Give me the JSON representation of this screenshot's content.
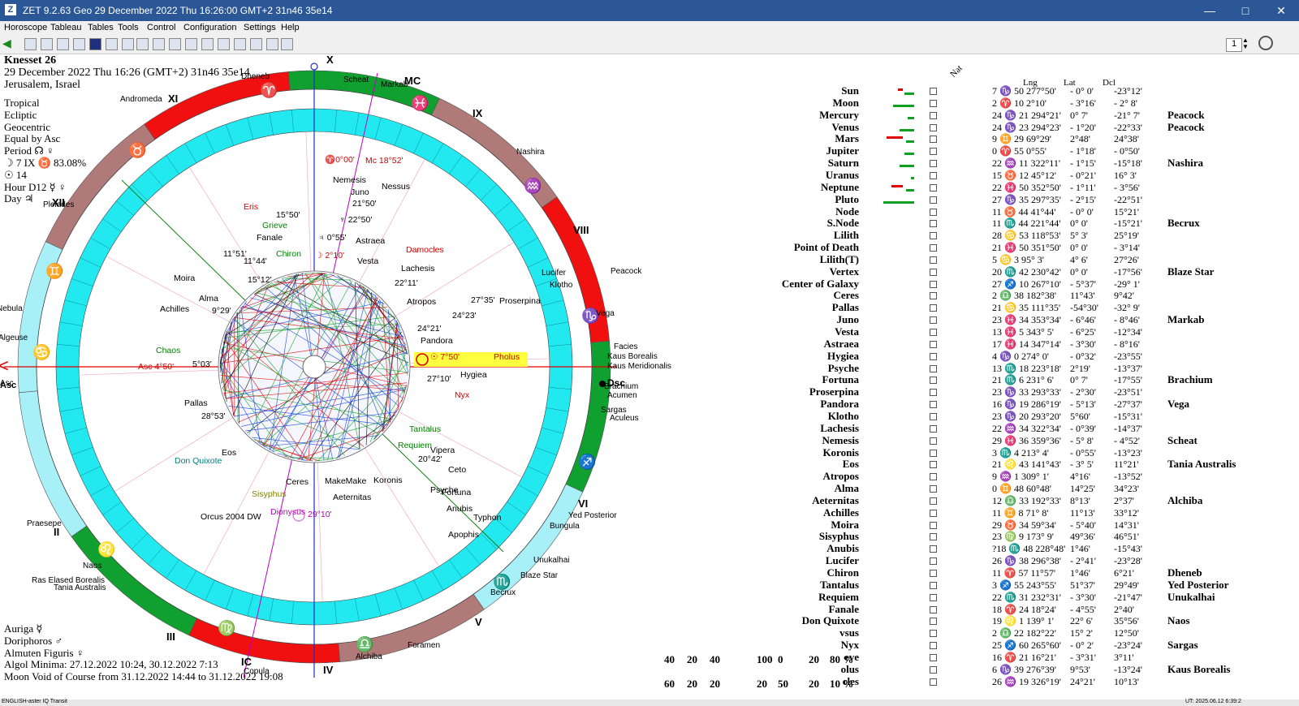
{
  "window": {
    "title": "ZET 9.2.63 Geo   29 December 2022  Thu  16:26:00 GMT+2 31n46  35e14",
    "app_icon": "zet-logo-icon",
    "controls": [
      "minimize",
      "maximize",
      "close"
    ]
  },
  "menu": [
    "Horoscope",
    "Tableau",
    "Tables",
    "Tools",
    "Control",
    "Configuration",
    "Settings",
    "Help"
  ],
  "toolbar": {
    "page_value": "1"
  },
  "chart_info": {
    "name": "Knesset 26",
    "datetime": "29 December 2022  Thu   16:26 (GMT+2) 31n46  35e14",
    "location": "Jerusalem, Israel",
    "lines": [
      "Tropical",
      "Ecliptic",
      "Geocentric",
      "Equal by Asc",
      "Period ☊ ♀",
      "☽ 7 IX ♉ 83.08%",
      "☉ 14",
      "Hour D12 ☿ ♀",
      "Day ♃"
    ]
  },
  "bottom_info": {
    "lines": [
      "Auriga ☿",
      "Doriphoros ♂",
      "Almuten Figuris ♀",
      "Algol Minima: 27.12.2022 10:24,  30.12.2022 7:13",
      "Moon Void of Course from 31.12.2022 14:44 to 31.12.2022 19:08"
    ]
  },
  "wheel": {
    "axis_labels": {
      "top": "X",
      "mc": "MC",
      "ic": "IC",
      "asc": "Asc",
      "dsc": "Dsc",
      "bottom": "IV"
    },
    "house_numbers": [
      "XI",
      "IX",
      "XII",
      "VIII",
      "II",
      "VI",
      "III",
      "V"
    ],
    "zodiac_glyphs": [
      "♈",
      "♓",
      "♒",
      "♑",
      "♐",
      "♏",
      "♎",
      "♍",
      "♌",
      "♋",
      "♊",
      "♉"
    ],
    "planet_labels": [
      {
        "text": "♈0°00'",
        "color": "#d00000"
      },
      {
        "text": "Mc 18°52'",
        "color": "#d00000"
      },
      {
        "text": "Asc 4°50'",
        "color": "#d00000"
      },
      {
        "text": "Nemesis",
        "color": "#000"
      },
      {
        "text": "Juno",
        "color": "#000"
      },
      {
        "text": "Nessus",
        "color": "#000"
      },
      {
        "text": "21°50'",
        "color": "#000"
      },
      {
        "text": "♆ 22°50'",
        "color": "#000"
      },
      {
        "text": "♃ 0°55'",
        "color": "#000"
      },
      {
        "text": "Astraea",
        "color": "#000"
      },
      {
        "text": "Damocles",
        "color": "#d00000"
      },
      {
        "text": "☽ 2°10'",
        "color": "#d00000"
      },
      {
        "text": "Vesta",
        "color": "#000"
      },
      {
        "text": "Lachesis",
        "color": "#000"
      },
      {
        "text": "22°11'",
        "color": "#000"
      },
      {
        "text": "Atropos",
        "color": "#000"
      },
      {
        "text": "27°35'",
        "color": "#000"
      },
      {
        "text": "Proserpina",
        "color": "#000"
      },
      {
        "text": "24°23'",
        "color": "#000"
      },
      {
        "text": "24°21'",
        "color": "#000"
      },
      {
        "text": "Pandora",
        "color": "#000"
      },
      {
        "text": "☉ 7°50'",
        "color": "#d00000"
      },
      {
        "text": "Pholus",
        "color": "#d00000"
      },
      {
        "text": "27°10'",
        "color": "#000"
      },
      {
        "text": "Hygiea",
        "color": "#000"
      },
      {
        "text": "Nyx",
        "color": "#d00000"
      },
      {
        "text": "Tantalus",
        "color": "#008000"
      },
      {
        "text": "Requiem",
        "color": "#008000"
      },
      {
        "text": "Vipera",
        "color": "#000"
      },
      {
        "text": "20°42'",
        "color": "#000"
      },
      {
        "text": "Ceto",
        "color": "#000"
      },
      {
        "text": "Fortuna",
        "color": "#000"
      },
      {
        "text": "Psyche",
        "color": "#000"
      },
      {
        "text": "Koronis",
        "color": "#000"
      },
      {
        "text": "MakeMake",
        "color": "#000"
      },
      {
        "text": "Aeternitas",
        "color": "#000"
      },
      {
        "text": "Anubis",
        "color": "#000"
      },
      {
        "text": "Typhon",
        "color": "#000"
      },
      {
        "text": "Apophis",
        "color": "#000"
      },
      {
        "text": "Ceres",
        "color": "#000"
      },
      {
        "text": "Sisyphus",
        "color": "#808000"
      },
      {
        "text": "Dionysus",
        "color": "#c000c0"
      },
      {
        "text": "29°10'",
        "color": "#c000c0"
      },
      {
        "text": "Orcus 2004 DW",
        "color": "#000"
      },
      {
        "text": "Don Quixote",
        "color": "#008080"
      },
      {
        "text": "Eos",
        "color": "#000"
      },
      {
        "text": "Pallas",
        "color": "#000"
      },
      {
        "text": "28°53'",
        "color": "#000"
      },
      {
        "text": "5°03'",
        "color": "#000"
      },
      {
        "text": "Chaos",
        "color": "#008000"
      },
      {
        "text": "Achilles",
        "color": "#000"
      },
      {
        "text": "9°29'",
        "color": "#000"
      },
      {
        "text": "Alma",
        "color": "#000"
      },
      {
        "text": "Moira",
        "color": "#000"
      },
      {
        "text": "15°12'",
        "color": "#000"
      },
      {
        "text": "11°51'",
        "color": "#000"
      },
      {
        "text": "11°44'",
        "color": "#000"
      },
      {
        "text": "Chiron",
        "color": "#008000"
      },
      {
        "text": "Fanale",
        "color": "#000"
      },
      {
        "text": "Grieve",
        "color": "#008000"
      },
      {
        "text": "15°50'",
        "color": "#000"
      },
      {
        "text": "Eris",
        "color": "#d00000"
      }
    ],
    "star_labels": [
      "Andromeda",
      "Dheneb",
      "Scheat",
      "Markab",
      "Nashira",
      "Peacock",
      "Vega",
      "Lucifer",
      "Klotho",
      "Facies",
      "Kaus Borealis",
      "Kaus Meridionalis",
      "Brachium",
      "Acumen",
      "Sargas",
      "Aculeus",
      "Yed Posterior",
      "Bungula",
      "Unukalhai",
      "Blaze Star",
      "Becrux",
      "Foramen",
      "Alchiba",
      "Copula",
      "Naos",
      "Ras Elased Borealis",
      "Tania Australis",
      "Praesepe",
      "Pleiades",
      "Nebula",
      "Algeuse",
      "Asc"
    ]
  },
  "table": {
    "headers": [
      "Nat",
      "Lng",
      "Lat",
      "Dcl"
    ],
    "rows": [
      {
        "name": "Sun",
        "lng": "7 ♑ 50  277°50'",
        "lat": "- 0° 0'",
        "dcl": "-23°12'",
        "star": ""
      },
      {
        "name": "Moon",
        "lng": "2 ♈ 10    2°10'",
        "lat": "- 3°16'",
        "dcl": "- 2° 8'",
        "star": ""
      },
      {
        "name": "Mercury",
        "lng": "24 ♑ 21  294°21'",
        "lat": "0° 7'",
        "dcl": "-21° 7'",
        "star": "Peacock"
      },
      {
        "name": "Venus",
        "lng": "24 ♑ 23  294°23'",
        "lat": "- 1°20'",
        "dcl": "-22°33'",
        "star": "Peacock"
      },
      {
        "name": "Mars",
        "lng": "9 ♊ 29   69°29'",
        "lat": "2°48'",
        "dcl": "24°38'",
        "star": ""
      },
      {
        "name": "Jupiter",
        "lng": "0 ♈ 55    0°55'",
        "lat": "- 1°18'",
        "dcl": "- 0°50'",
        "star": ""
      },
      {
        "name": "Saturn",
        "lng": "22 ♒ 11  322°11'",
        "lat": "- 1°15'",
        "dcl": "-15°18'",
        "star": "Nashira"
      },
      {
        "name": "Uranus",
        "lng": "15 ♉ 12   45°12'",
        "lat": "- 0°21'",
        "dcl": "16° 3'",
        "star": ""
      },
      {
        "name": "Neptune",
        "lng": "22 ♓ 50  352°50'",
        "lat": "- 1°11'",
        "dcl": "- 3°56'",
        "star": ""
      },
      {
        "name": "Pluto",
        "lng": "27 ♑ 35  297°35'",
        "lat": "- 2°15'",
        "dcl": "-22°51'",
        "star": ""
      },
      {
        "name": "Node",
        "lng": "11 ♉ 44   41°44'",
        "lat": "- 0° 0'",
        "dcl": "15°21'",
        "star": ""
      },
      {
        "name": "S.Node",
        "lng": "11 ♏ 44  221°44'",
        "lat": "0° 0'",
        "dcl": "-15°21'",
        "star": "Becrux"
      },
      {
        "name": "Lilith",
        "lng": "28 ♋ 53  118°53'",
        "lat": "5° 3'",
        "dcl": "25°19'",
        "star": ""
      },
      {
        "name": "Point of Death",
        "lng": "21 ♓ 50  351°50'",
        "lat": "0° 0'",
        "dcl": "- 3°14'",
        "star": ""
      },
      {
        "name": "Lilith(T)",
        "lng": "5 ♋ 3   95° 3'",
        "lat": "4° 6'",
        "dcl": "27°26'",
        "star": ""
      },
      {
        "name": "Vertex",
        "lng": "20 ♏ 42  230°42'",
        "lat": "0° 0'",
        "dcl": "-17°56'",
        "star": "Blaze Star"
      },
      {
        "name": "Center of Galaxy",
        "lng": "27 ♐ 10  267°10'",
        "lat": "- 5°37'",
        "dcl": "-29° 1'",
        "star": ""
      },
      {
        "name": "Ceres",
        "lng": "2 ♎ 38  182°38'",
        "lat": "11°43'",
        "dcl": "9°42'",
        "star": ""
      },
      {
        "name": "Pallas",
        "lng": "21 ♋ 35  111°35'",
        "lat": "-54°30'",
        "dcl": "-32° 9'",
        "star": ""
      },
      {
        "name": "Juno",
        "lng": "23 ♓ 34  353°34'",
        "lat": "- 6°46'",
        "dcl": "- 8°46'",
        "star": "Markab"
      },
      {
        "name": "Vesta",
        "lng": "13 ♓ 5  343° 5'",
        "lat": "- 6°25'",
        "dcl": "-12°34'",
        "star": ""
      },
      {
        "name": "Astraea",
        "lng": "17 ♓ 14  347°14'",
        "lat": "- 3°30'",
        "dcl": "- 8°16'",
        "star": ""
      },
      {
        "name": "Hygiea",
        "lng": "4 ♑ 0  274° 0'",
        "lat": "- 0°32'",
        "dcl": "-23°55'",
        "star": ""
      },
      {
        "name": "Psyche",
        "lng": "13 ♏ 18  223°18'",
        "lat": "2°19'",
        "dcl": "-13°37'",
        "star": ""
      },
      {
        "name": "Fortuna",
        "lng": "21 ♏ 6  231° 6'",
        "lat": "0° 7'",
        "dcl": "-17°55'",
        "star": "Brachium"
      },
      {
        "name": "Proserpina",
        "lng": "23 ♑ 33  293°33'",
        "lat": "- 2°30'",
        "dcl": "-23°51'",
        "star": ""
      },
      {
        "name": "Pandora",
        "lng": "16 ♑ 19  286°19'",
        "lat": "- 5°13'",
        "dcl": "-27°37'",
        "star": "Vega"
      },
      {
        "name": "Klotho",
        "lng": "23 ♑ 20  293°20'",
        "lat": "5°60'",
        "dcl": "-15°31'",
        "star": ""
      },
      {
        "name": "Lachesis",
        "lng": "22 ♒ 34  322°34'",
        "lat": "- 0°39'",
        "dcl": "-14°37'",
        "star": ""
      },
      {
        "name": "Nemesis",
        "lng": "29 ♓ 36  359°36'",
        "lat": "- 5° 8'",
        "dcl": "- 4°52'",
        "star": "Scheat"
      },
      {
        "name": "Koronis",
        "lng": "3 ♏ 4  213° 4'",
        "lat": "- 0°55'",
        "dcl": "-13°23'",
        "star": ""
      },
      {
        "name": "Eos",
        "lng": "21 ♌ 43  141°43'",
        "lat": "- 3° 5'",
        "dcl": "11°21'",
        "star": "Tania Australis"
      },
      {
        "name": "Atropos",
        "lng": "9 ♒ 1  309° 1'",
        "lat": "4°16'",
        "dcl": "-13°52'",
        "star": ""
      },
      {
        "name": "Alma",
        "lng": "0 ♊ 48   60°48'",
        "lat": "14°25'",
        "dcl": "34°23'",
        "star": ""
      },
      {
        "name": "Aeternitas",
        "lng": "12 ♎ 33  192°33'",
        "lat": "8°13'",
        "dcl": "2°37'",
        "star": "Alchiba"
      },
      {
        "name": "Achilles",
        "lng": "11 ♊ 8   71° 8'",
        "lat": "11°13'",
        "dcl": "33°12'",
        "star": ""
      },
      {
        "name": "Moira",
        "lng": "29 ♉ 34   59°34'",
        "lat": "- 5°40'",
        "dcl": "14°31'",
        "star": ""
      },
      {
        "name": "Sisyphus",
        "lng": "23 ♍ 9  173° 9'",
        "lat": "49°36'",
        "dcl": "46°51'",
        "star": ""
      },
      {
        "name": "Anubis",
        "lng": "?18 ♏ 48  228°48'",
        "lat": "1°46'",
        "dcl": "-15°43'",
        "star": ""
      },
      {
        "name": "Lucifer",
        "lng": "26 ♑ 38  296°38'",
        "lat": "- 2°41'",
        "dcl": "-23°28'",
        "star": ""
      },
      {
        "name": "Chiron",
        "lng": "11 ♈ 57   11°57'",
        "lat": "1°46'",
        "dcl": "6°21'",
        "star": "Dheneb"
      },
      {
        "name": "Tantalus",
        "lng": "3 ♐ 55  243°55'",
        "lat": "51°37'",
        "dcl": "29°49'",
        "star": "Yed Posterior"
      },
      {
        "name": "Requiem",
        "lng": "22 ♏ 31  232°31'",
        "lat": "- 3°30'",
        "dcl": "-21°47'",
        "star": "Unukalhai"
      },
      {
        "name": "Fanale",
        "lng": "18 ♈ 24   18°24'",
        "lat": "- 4°55'",
        "dcl": "2°40'",
        "star": ""
      },
      {
        "name": "Don Quixote",
        "lng": "19 ♌ 1  139° 1'",
        "lat": "22° 6'",
        "dcl": "35°56'",
        "star": "Naos"
      },
      {
        "name": "vsus",
        "lng": "2 ♎ 22  182°22'",
        "lat": "15° 2'",
        "dcl": "12°50'",
        "star": ""
      },
      {
        "name": "Nyx",
        "lng": "25 ♐ 60  265°60'",
        "lat": "- 0° 2'",
        "dcl": "-23°24'",
        "star": "Sargas"
      },
      {
        "name": "eve",
        "lng": "16 ♈ 21   16°21'",
        "lat": "- 3°31'",
        "dcl": "3°11'",
        "star": ""
      },
      {
        "name": "olus",
        "lng": "6 ♑ 39  276°39'",
        "lat": "9°53'",
        "dcl": "-13°24'",
        "star": "Kaus Borealis"
      },
      {
        "name": "cles",
        "lng": "26 ♒ 19  326°19'",
        "lat": "24°21'",
        "dcl": "10°13'",
        "star": ""
      }
    ]
  },
  "stats": {
    "row1": [
      "40",
      "20",
      "40",
      "100",
      "0",
      "20",
      "80 %"
    ],
    "row2": [
      "60",
      "20",
      "20",
      "20",
      "50",
      "20",
      "10 %"
    ]
  },
  "statusbar": {
    "left": "ENGLISH-aster IQ Transit",
    "right": "UT: 2025.06.12 6:39:2"
  },
  "colors": {
    "titlebar": "#2b5797",
    "red_sector": "#f01010",
    "green_sector": "#10a030",
    "brown_sector": "#b07a78",
    "light_cyan": "#a8f0f8",
    "cyan_band": "#22e8f0"
  }
}
